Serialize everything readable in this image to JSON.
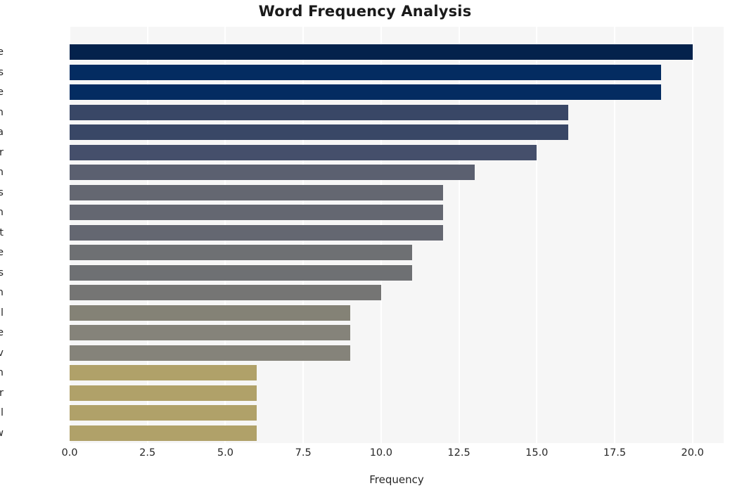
{
  "chart_data": {
    "type": "bar",
    "orientation": "horizontal",
    "title": "Word Frequency Analysis",
    "xlabel": "Frequency",
    "ylabel": "",
    "categories": [
      "state",
      "voters",
      "remove",
      "election",
      "virginia",
      "voter",
      "program",
      "citizens",
      "wilson",
      "court",
      "vote",
      "noncitizens",
      "registration",
      "roll",
      "people",
      "dmv",
      "citizen",
      "order",
      "federal",
      "shaw"
    ],
    "values": [
      20,
      19,
      19,
      16,
      16,
      15,
      13,
      12,
      12,
      12,
      11,
      11,
      10,
      9,
      9,
      9,
      6,
      6,
      6,
      6
    ],
    "bar_colors": [
      "#04224c",
      "#042c61",
      "#042c61",
      "#394766",
      "#394766",
      "#454f6b",
      "#5b6070",
      "#646771",
      "#646771",
      "#646771",
      "#6e7073",
      "#6e7073",
      "#757574",
      "#848276",
      "#85837a",
      "#85837a",
      "#b0a169",
      "#b0a169",
      "#b0a169",
      "#b0a169"
    ],
    "xlim": [
      0,
      21.0
    ],
    "xticks": [
      "0.0",
      "2.5",
      "5.0",
      "7.5",
      "10.0",
      "12.5",
      "15.0",
      "17.5",
      "20.0"
    ],
    "xtick_values": [
      0,
      2.5,
      5,
      7.5,
      10,
      12.5,
      15,
      17.5,
      20
    ],
    "grid": true,
    "grid_axis": "x",
    "plot_background": "#f6f6f6",
    "gridline_color": "#ffffff",
    "figure_background": "#ffffff",
    "legend": null
  }
}
